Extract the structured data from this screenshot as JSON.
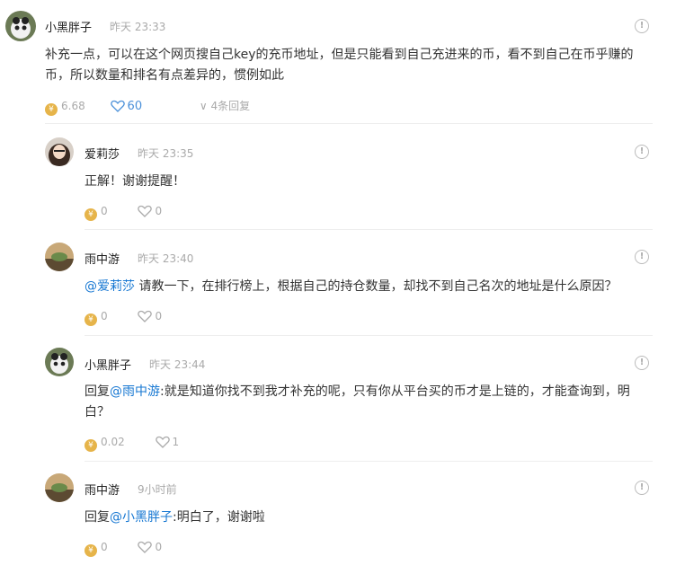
{
  "comments": [
    {
      "name": "小黑胖子",
      "time": "昨天 23:33",
      "text": "补充一点，可以在这个网页搜自己key的充币地址，但是只能看到自己充进来的币，看不到自己在币乎赚的币，所以数量和排名有点差异的，惯例如此",
      "coins": "6.68",
      "likes": "60",
      "replies": "4条回复"
    },
    {
      "name": "爱莉莎",
      "time": "昨天 23:35",
      "text": "正解！谢谢提醒！",
      "coins": "0",
      "likes": "0"
    },
    {
      "name": "雨中游",
      "time": "昨天 23:40",
      "mention": "@爱莉莎",
      "text": " 请教一下，在排行榜上，根据自己的持仓数量，却找不到自己名次的地址是什么原因？",
      "coins": "0",
      "likes": "0"
    },
    {
      "name": "小黑胖子",
      "time": "昨天 23:44",
      "prefix": "回复",
      "mention": "@雨中游",
      "text": ":就是知道你找不到我才补充的呢，只有你从平台买的币才是上链的，才能查询到，明白？",
      "coins": "0.02",
      "likes": "1"
    },
    {
      "name": "雨中游",
      "time": "9小时前",
      "prefix": "回复",
      "mention": "@小黑胖子",
      "text": ":明白了，谢谢啦",
      "coins": "0",
      "likes": "0"
    }
  ],
  "icons": {
    "coin": "coin-icon",
    "heart": "heart-icon",
    "warn": "report-icon",
    "chevron": "chevron-down-icon"
  },
  "colors": {
    "mention": "#1677d2",
    "coin": "#e6b44a",
    "like_active": "#4a90d9"
  }
}
